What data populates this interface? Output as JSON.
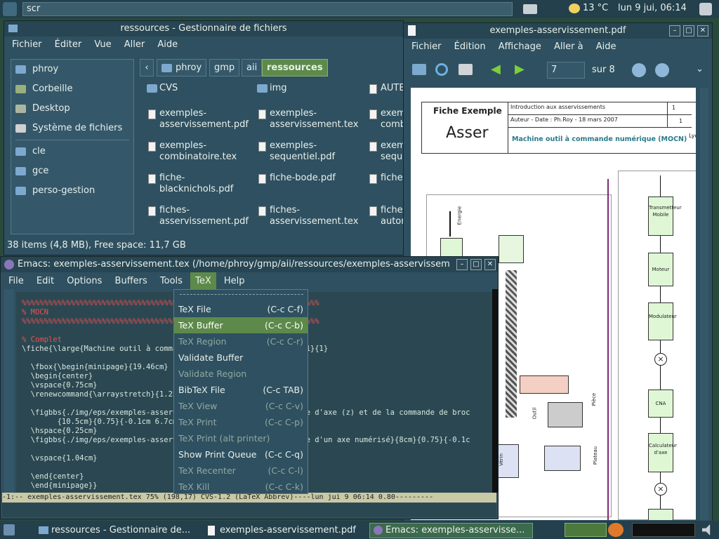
{
  "topbar": {
    "search_value": "scr",
    "weather": "13 °C",
    "clock": "lun  9 jui, 06:14"
  },
  "filemanager": {
    "title": "ressources - Gestionnaire de fichiers",
    "menu": [
      "Fichier",
      "Éditer",
      "Vue",
      "Aller",
      "Aide"
    ],
    "sidebar": [
      "phroy",
      "Corbeille",
      "Desktop",
      "Système de fichiers",
      "cle",
      "gce",
      "perso-gestion"
    ],
    "crumbs": [
      "phroy",
      "gmp",
      "aii",
      "ressources"
    ],
    "files": [
      {
        "name1": "CVS",
        "name2": ""
      },
      {
        "name1": "img",
        "name2": ""
      },
      {
        "name1": "AUTE",
        "name2": ""
      },
      {
        "name1": "exemples-",
        "name2": "asservissement.pdf"
      },
      {
        "name1": "exemples-",
        "name2": "asservissement.tex"
      },
      {
        "name1": "exem",
        "name2": "comb"
      },
      {
        "name1": "exemples-",
        "name2": "combinatoire.tex"
      },
      {
        "name1": "exemples-",
        "name2": "sequentiel.pdf"
      },
      {
        "name1": "exem",
        "name2": "seque"
      },
      {
        "name1": "fiche-",
        "name2": "blacknichols.pdf"
      },
      {
        "name1": "fiche-bode.pdf",
        "name2": ""
      },
      {
        "name1": "fiche-",
        "name2": ""
      },
      {
        "name1": "fiches-",
        "name2": "asservissement.pdf"
      },
      {
        "name1": "fiches-",
        "name2": "asservissement.tex"
      },
      {
        "name1": "fiches",
        "name2": "autor"
      }
    ],
    "status": "38 items (4,8 MB), Free space: 11,7 GB"
  },
  "pdfviewer": {
    "title": "exemples-asservissement.pdf",
    "menu": [
      "Fichier",
      "Édition",
      "Affichage",
      "Aller à",
      "Aide"
    ],
    "page": "7",
    "total": "sur 8",
    "doc": {
      "heading": "Fiche Exemple",
      "big": "Asser",
      "intro": "Introduction aux asservissements",
      "author": "Auteur - Date : Ph.Roy - 18 mars 2007",
      "subject": "Machine outil à commande numérique (MOCN)",
      "num1": "1",
      "num2": "1",
      "side": "Lyc",
      "energie": "Energie",
      "boxes": [
        "Transmetteur Mobile",
        "Moteur",
        "Modulateur",
        "CNA",
        "Calculateur d'axe"
      ],
      "outil": "Outil",
      "piece": "Pièce",
      "plateau": "Plateau",
      "verin": "Vérin"
    }
  },
  "emacs": {
    "title": "Emacs: exemples-asservissement.tex (/home/phroy/gmp/aii/ressources/exemples-asservissem",
    "menu": [
      "File",
      "Edit",
      "Options",
      "Buffers",
      "Tools",
      "TeX",
      "Help"
    ],
    "lines": [
      {
        "text": "%%%%%%%%%%%%%%%%%%%%%%%%%%%%%%%%%%%%%%%%%%%%%%%%%%%%%%%%%%%%%%%%%%%",
        "cls": "red"
      },
      {
        "text": "% MOCN",
        "cls": "red"
      },
      {
        "text": "%%%%%%%%%%%%%%%%%%%%%%%%%%%%%%%%%%%%%%%%%%%%%%%%%%%%%%%%%%%%%%%%%%%",
        "cls": "red"
      },
      {
        "text": "",
        "cls": ""
      },
      {
        "text": "% Complet",
        "cls": "red"
      },
      {
        "text": "\\fiche{\\large{Machine outil à comman                       ple}{1}{1}",
        "cls": ""
      },
      {
        "text": "",
        "cls": ""
      },
      {
        "text": "  \\fbox{\\begin{minipage}{19.46cm}",
        "cls": ""
      },
      {
        "text": "  \\begin{center}",
        "cls": ""
      },
      {
        "text": "  \\vspace{0.75cm}",
        "cls": ""
      },
      {
        "text": "  \\renewcommand{\\arraystretch}{1.25}",
        "cls": ""
      },
      {
        "text": "",
        "cls": ""
      },
      {
        "text": "  \\figbbs{./img/eps/exemples-asservi                      ommande d'axe (z) et de la commande de broc",
        "cls": ""
      },
      {
        "text": "        {10.5cm}{0.75}{-0.1cm 6.7cm",
        "cls": ""
      },
      {
        "text": "  \\hspace{0.25cm}",
        "cls": ""
      },
      {
        "text": "  \\figbbs{./img/eps/exemples-asservi                      rincipe d'un axe numérisé}{8cm}{0.75}{-0.1c",
        "cls": ""
      },
      {
        "text": "",
        "cls": ""
      },
      {
        "text": "  \\vspace{1.04cm}",
        "cls": ""
      },
      {
        "text": "",
        "cls": ""
      },
      {
        "text": "  \\end{center}",
        "cls": ""
      },
      {
        "text": "  \\end{minipage}}",
        "cls": ""
      }
    ],
    "modeline": "-1:--  exemples-asservissement.tex   75% (198,17)  CVS-1.2  (LaTeX Abbrev)----lun jui  9 06:14 0.80---------",
    "tex_menu": [
      {
        "label": "TeX File",
        "key": "(C-c C-f)",
        "state": ""
      },
      {
        "label": "TeX Buffer",
        "key": "(C-c C-b)",
        "state": "sel"
      },
      {
        "label": "TeX Region",
        "key": "(C-c C-r)",
        "state": "dis"
      },
      {
        "label": "Validate Buffer",
        "key": "",
        "state": ""
      },
      {
        "label": "Validate Region",
        "key": "",
        "state": "dis"
      },
      {
        "label": "BibTeX File",
        "key": "(C-c TAB)",
        "state": ""
      },
      {
        "label": "TeX View",
        "key": "(C-c C-v)",
        "state": "dis"
      },
      {
        "label": "TeX Print",
        "key": "(C-c C-p)",
        "state": "dis"
      },
      {
        "label": "TeX Print (alt printer)",
        "key": "",
        "state": "dis"
      },
      {
        "label": "Show Print Queue",
        "key": "(C-c C-q)",
        "state": ""
      },
      {
        "label": "TeX Recenter",
        "key": "(C-c C-l)",
        "state": "dis"
      },
      {
        "label": "TeX Kill",
        "key": "(C-c C-k)",
        "state": "dis"
      }
    ]
  },
  "taskbar": [
    "ressources - Gestionnaire de...",
    "exemples-asservissement.pdf",
    "Emacs: exemples-asservisse..."
  ]
}
